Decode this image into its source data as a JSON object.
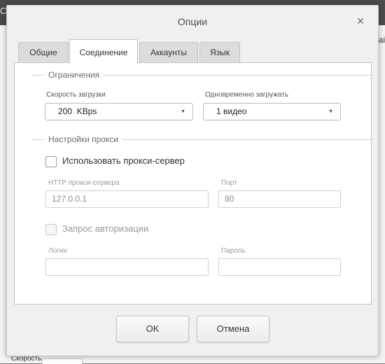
{
  "background": {
    "topbar_text": "Сп",
    "toolbar_right_text": "Заі",
    "bottom_label": "Скорость"
  },
  "dialog": {
    "title": "Опции",
    "close_icon": "×"
  },
  "tabs": [
    {
      "label": "Общие",
      "active": false
    },
    {
      "label": "Соединение",
      "active": true
    },
    {
      "label": "Аккаунты",
      "active": false
    },
    {
      "label": "Язык",
      "active": false
    }
  ],
  "limits": {
    "legend": "Ограничения",
    "speed": {
      "label": "Скорость загрузки",
      "value": "200  KBps"
    },
    "concurrent": {
      "label": "Одновременно загружать",
      "value": "1 видео"
    },
    "caret_icon": "▼"
  },
  "proxy": {
    "legend": "Настройки прокси",
    "use_proxy": {
      "label": "Использовать прокси-сервер",
      "checked": false
    },
    "http_server": {
      "label": "HTTP прокси-сервера",
      "value": "127.0.0.1"
    },
    "port": {
      "label": "Порт",
      "value": "80"
    },
    "auth": {
      "label": "Запрос авторизации",
      "checked": false
    },
    "login": {
      "label": "Логин",
      "value": ""
    },
    "password": {
      "label": "Пароль",
      "value": ""
    }
  },
  "buttons": {
    "ok": "OK",
    "cancel": "Отмена"
  },
  "colors": {
    "dialog_bg": "#f0f0f0",
    "panel_bg": "#ffffff",
    "border": "#c4c4c4"
  }
}
